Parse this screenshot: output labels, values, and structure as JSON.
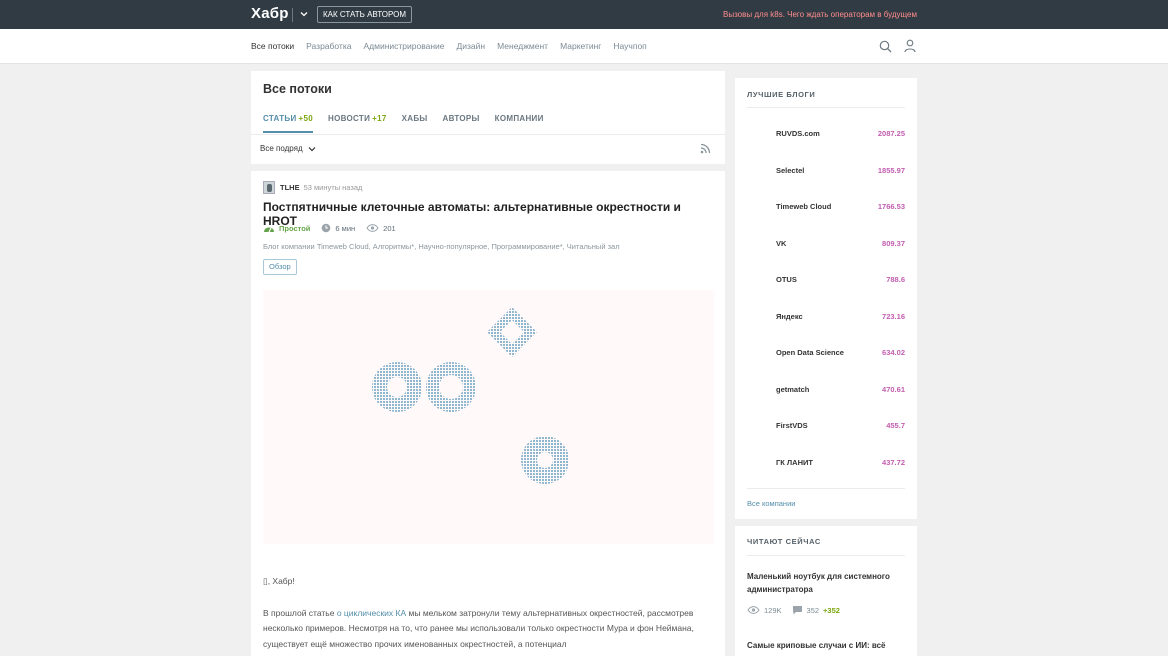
{
  "topbar": {
    "logo": "Хабр",
    "author_button": "КАК СТАТЬ АВТОРОМ",
    "promo": "Вызовы для k8s. Чего ждать операторам в будущем"
  },
  "nav": {
    "items": [
      "Все потоки",
      "Разработка",
      "Администрирование",
      "Дизайн",
      "Менеджмент",
      "Маркетинг",
      "Научпоп"
    ]
  },
  "header": {
    "title": "Все потоки",
    "tabs": [
      {
        "label": "СТАТЬИ",
        "count": "+50"
      },
      {
        "label": "НОВОСТИ",
        "count": "+17"
      },
      {
        "label": "ХАБЫ",
        "count": ""
      },
      {
        "label": "АВТОРЫ",
        "count": ""
      },
      {
        "label": "КОМПАНИИ",
        "count": ""
      }
    ],
    "filter": "Все подряд"
  },
  "article": {
    "author": "TLHE",
    "time": "53 минуты назад",
    "title": "Постпятничные клеточные автоматы: альтернативные окрестности и HROT",
    "level": "Простой",
    "read_time": "6 мин",
    "views": "201",
    "hubs": "Блог компании Timeweb Cloud, Алгоритмы*, Научно-популярное, Программирование*, Читальный зал",
    "badge": "Обзор",
    "greeting": ", Хабр!",
    "para_before_link": "В прошлой статье ",
    "para_link": "о циклических КА",
    "para_after_link": " мы мельком затронули тему альтернативных окрестностей, рассмотрев несколько примеров. Несмотря на то, что ранее мы использовали только окрестности Мура и фон Неймана, существует ещё множество прочих именованных окрестностей, а потенциал"
  },
  "sidebar": {
    "blogs_title": "ЛУЧШИЕ БЛОГИ",
    "blogs": [
      {
        "name": "RUVDS.com",
        "rating": "2087.25"
      },
      {
        "name": "Selectel",
        "rating": "1855.97"
      },
      {
        "name": "Timeweb Cloud",
        "rating": "1766.53"
      },
      {
        "name": "VK",
        "rating": "809.37"
      },
      {
        "name": "OTUS",
        "rating": "788.6"
      },
      {
        "name": "Яндекс",
        "rating": "723.16"
      },
      {
        "name": "Open Data Science",
        "rating": "634.02"
      },
      {
        "name": "getmatch",
        "rating": "470.61"
      },
      {
        "name": "FirstVDS",
        "rating": "455.7"
      },
      {
        "name": "ГК ЛАНИТ",
        "rating": "437.72"
      }
    ],
    "all_companies": "Все компании",
    "reading_title": "ЧИТАЮТ СЕЙЧАС",
    "reading": [
      {
        "title": "Маленький ноутбук для системного администратора",
        "views": "129K",
        "comments": "352",
        "new_comments": "+352"
      },
      {
        "title": "Самые криповые случаи с ИИ: всё"
      }
    ]
  },
  "colors": {
    "topbar": "#303b44",
    "accent": "#548eaa",
    "rating": "#c25db0",
    "positive": "#7ba60d"
  }
}
